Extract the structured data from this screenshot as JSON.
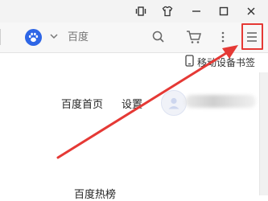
{
  "window": {
    "controls": [
      "restore-icon",
      "shirt-icon",
      "minimize-icon",
      "maximize-icon",
      "close-icon"
    ]
  },
  "address": {
    "placeholder": "百度",
    "engine_icon": "baidu-paw-icon"
  },
  "toolbar": {
    "icons": [
      "search-icon",
      "cart-icon",
      "more-dots-icon",
      "hamburger-menu-icon"
    ]
  },
  "bookmarks": {
    "mobile_label": "移动设备书签"
  },
  "page": {
    "nav": {
      "home": "百度首页",
      "settings": "设置"
    },
    "hot_title": "百度热榜"
  },
  "annotation": {
    "color": "#e53935"
  }
}
